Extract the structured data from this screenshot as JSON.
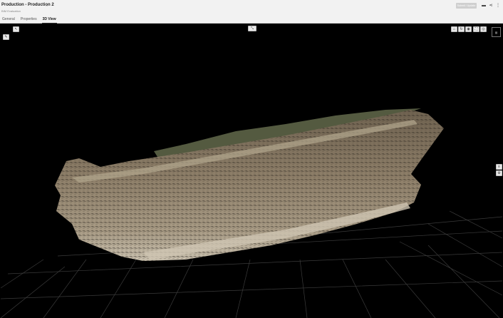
{
  "header": {
    "title": "Production - Production 2",
    "subtitle": "BIM Evaluation",
    "action_button": "Submit / Update"
  },
  "tabs": [
    {
      "label": "General",
      "active": false
    },
    {
      "label": "Properties",
      "active": false
    },
    {
      "label": "3D View",
      "active": true
    }
  ],
  "icons": {
    "star": "star-icon",
    "folder": "folder-icon",
    "share": "share-icon",
    "more": "more-vertical-icon",
    "cursor": "cursor-icon",
    "pen": "pen-icon",
    "expand": "expand-icon",
    "compass": "view-cube-icon"
  },
  "colors": {
    "header_bg": "#f2f2f2",
    "viewer_bg": "#000000",
    "terrain": "#8a7b66"
  }
}
